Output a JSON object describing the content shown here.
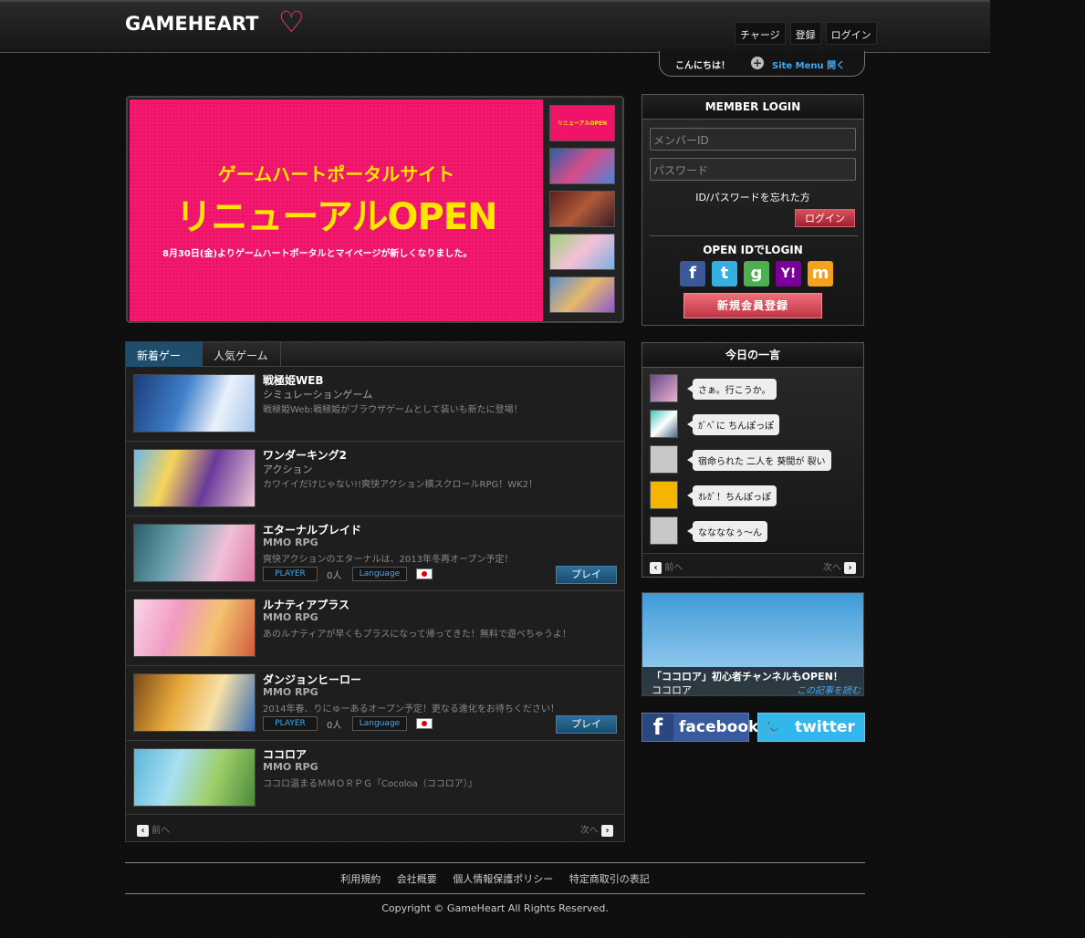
{
  "header": {
    "logo_text": "GAMEHEART",
    "nav": [
      "チャージ",
      "登録",
      "ログイン"
    ],
    "hello": "こんにちは！",
    "site_menu": "Site Menu 開く"
  },
  "banner": {
    "subtitle": "ゲームハートポータルサイト",
    "headline": "リニューアルOPEN",
    "description": "8月30日(金)よりゲームハートポータルとマイページが新しくなりました。",
    "thumb_label": "リニューアルOPEN"
  },
  "game_tabs": [
    "新着ゲーム",
    "人気ゲーム"
  ],
  "games": [
    {
      "title": "戦極姫WEB",
      "genre": "シミュレーションゲーム",
      "desc": "戦極姫Web:戦極姫がブラウザゲームとして装いも新たに登場！"
    },
    {
      "title": "ワンダーキング2",
      "genre": "アクション",
      "desc": "カワイイだけじゃない!!爽快アクション横スクロールRPG！WK2！"
    },
    {
      "title": "エターナルブレイド",
      "genre": "MMO RPG",
      "desc": "爽快アクションのエターナルは、2013年冬再オープン予定！",
      "player_label": "PLAYER",
      "count": "0人",
      "lang_label": "Language",
      "play_label": "プレイ"
    },
    {
      "title": "ルナティアプラス",
      "genre": "MMO RPG",
      "desc": "あのルナティアが早くもプラスになって帰ってきた！無料で遊べちゃうよ！"
    },
    {
      "title": "ダンジョンヒーロー",
      "genre": "MMO RPG",
      "desc": "2014年春、りにゅーあるオープン予定！更なる進化をお待ちください！",
      "player_label": "PLAYER",
      "count": "0人",
      "lang_label": "Language",
      "play_label": "プレイ"
    },
    {
      "title": "ココロア",
      "genre": "MMO RPG",
      "desc": "ココロ温まるＭＭＯＲＰＧ『Cocoloa（ココロア）』"
    }
  ],
  "pager": {
    "prev": "前へ",
    "next": "次へ"
  },
  "login": {
    "title": "MEMBER LOGIN",
    "id_placeholder": "メンバーID",
    "pw_placeholder": "パスワード",
    "forgot": "ID/パスワードを忘れた方",
    "login_button": "ログイン",
    "openid_title": "OPEN IDでLOGIN",
    "sns": [
      {
        "name": "facebook-icon",
        "glyph": "f",
        "color": "#3b5998"
      },
      {
        "name": "twitter-icon",
        "glyph": "t",
        "color": "#35aee2"
      },
      {
        "name": "google-icon",
        "glyph": "g",
        "color": "#4caf50"
      },
      {
        "name": "yahoo-icon",
        "glyph": "Y!",
        "color": "#7b0099"
      },
      {
        "name": "mixi-icon",
        "glyph": "m",
        "color": "#f4a21b"
      }
    ],
    "register_button": "新規会員登録"
  },
  "today": {
    "title": "今日の一言",
    "messages": [
      "さぁ。行こうか。",
      "ｶﾞﾍﾞに ちんぽっぽ",
      "宿命られた 二人を 葵間が 裂い",
      "ｵﾚｶﾞ！ちんぽっぽ",
      "ななななぅ～ん"
    ]
  },
  "ad": {
    "caption": "「ココロア」初心者チャンネルもOPEN！",
    "game": "ココロア",
    "read_more": "この記事を読む"
  },
  "social": {
    "facebook": "facebook",
    "twitter": "twitter"
  },
  "footer": {
    "links": [
      "利用規約",
      "会社概要",
      "個人情報保護ポリシー",
      "特定商取引の表記"
    ],
    "copyright": "Copyright © GameHeart All Rights Reserved."
  }
}
